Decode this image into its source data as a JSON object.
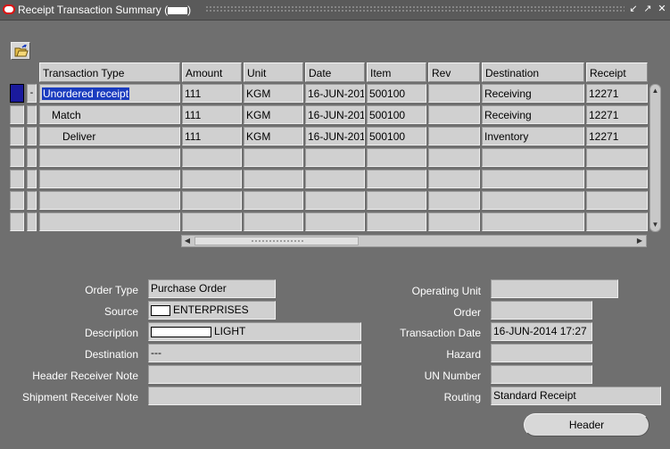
{
  "window": {
    "title": "Receipt Transaction Summary (",
    "title_suffix": ")",
    "minimize": "↙",
    "maximize": "↗",
    "close": "✕"
  },
  "table": {
    "headers": [
      "Transaction Type",
      "Amount",
      "Unit",
      "Date",
      "Item",
      "Rev",
      "Destination",
      "Receipt"
    ],
    "rows": [
      {
        "indicator": "-",
        "type": "Unordered receipt",
        "amount": "111",
        "unit": "KGM",
        "date": "16-JUN-201",
        "item": "500100",
        "rev": "",
        "destination": "Receiving",
        "receipt": "12271"
      },
      {
        "indicator": "",
        "type": "Match",
        "amount": "111",
        "unit": "KGM",
        "date": "16-JUN-201",
        "item": "500100",
        "rev": "",
        "destination": "Receiving",
        "receipt": "12271"
      },
      {
        "indicator": "",
        "type": "Deliver",
        "amount": "111",
        "unit": "KGM",
        "date": "16-JUN-201",
        "item": "500100",
        "rev": "",
        "destination": "Inventory",
        "receipt": "12271"
      }
    ]
  },
  "form": {
    "order_type_label": "Order Type",
    "order_type_value": "Purchase Order",
    "source_label": "Source",
    "source_value": "ENTERPRISES",
    "description_label": "Description",
    "description_value": "LIGHT",
    "destination_label": "Destination",
    "destination_value": "---",
    "header_note_label": "Header Receiver Note",
    "shipment_note_label": "Shipment Receiver Note",
    "operating_unit_label": "Operating Unit",
    "order_label": "Order",
    "transaction_date_label": "Transaction Date",
    "transaction_date_value": "16-JUN-2014 17:27",
    "hazard_label": "Hazard",
    "un_number_label": "UN Number",
    "routing_label": "Routing",
    "routing_value": "Standard Receipt"
  },
  "buttons": {
    "header": "Header"
  }
}
